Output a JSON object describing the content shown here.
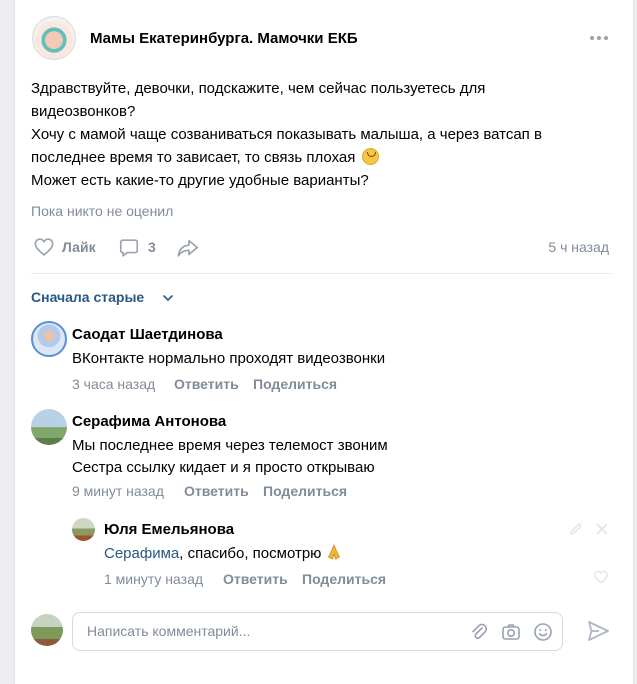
{
  "post": {
    "group_name": "Мамы Екатеринбурга. Мамочки ЕКБ",
    "text_lines": [
      "Здравствуйте, девочки, подскажите, чем сейчас пользуетесь для",
      "видеозвонков?",
      "Хочу с мамой чаще созваниваться показывать малыша, а через ватсап в",
      "последнее время то зависает, то связь плохая",
      "Может есть какие-то другие удобные варианты?"
    ],
    "no_rating": "Пока никто не оценил",
    "like_label": "Лайк",
    "comment_count": "3",
    "time_ago": "5 ч назад"
  },
  "comments_header": {
    "sort_label": "Сначала старые"
  },
  "comments": [
    {
      "author": "Саодат Шаетдинова",
      "text_lines": [
        "ВКонтакте нормально проходят видеозвонки"
      ],
      "time": "3 часа назад",
      "reply_label": "Ответить",
      "share_label": "Поделиться"
    },
    {
      "author": "Серафима Антонова",
      "text_lines": [
        "Мы последнее время через телемост звоним",
        "Сестра ссылку кидает и я просто открываю"
      ],
      "time": "9 минут назад",
      "reply_label": "Ответить",
      "share_label": "Поделиться"
    }
  ],
  "reply": {
    "author": "Юля Емельянова",
    "mention": "Серафима",
    "text": ", спасибо, посмотрю",
    "time": "1 минуту назад",
    "reply_label": "Ответить",
    "share_label": "Поделиться"
  },
  "composer": {
    "placeholder": "Написать комментарий..."
  },
  "colors": {
    "link": "#2a5885",
    "muted": "#818c99",
    "accent": "#5181b8"
  }
}
